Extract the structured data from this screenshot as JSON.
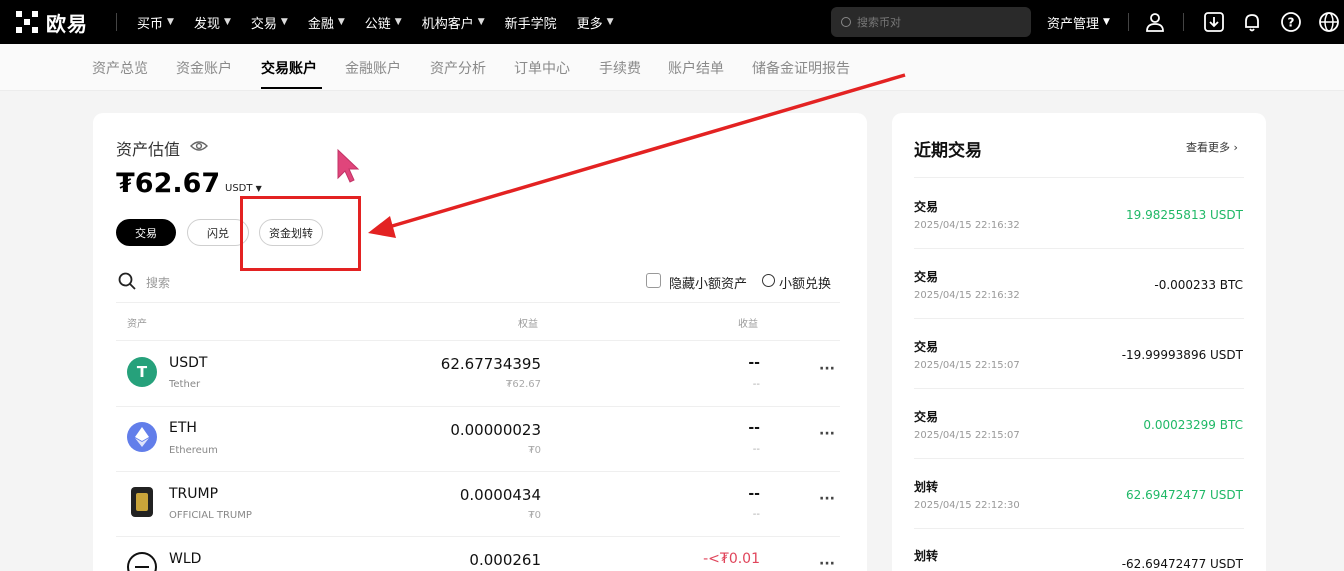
{
  "brand": {
    "name": "欧易"
  },
  "topnav": {
    "items": [
      "买币",
      "发现",
      "交易",
      "金融",
      "公链",
      "机构客户",
      "新手学院",
      "更多"
    ],
    "search_placeholder": "搜索币对",
    "asset_mgmt": "资产管理"
  },
  "subtabs": [
    "资产总览",
    "资金账户",
    "交易账户",
    "金融账户",
    "资产分析",
    "订单中心",
    "手续费",
    "账户结单",
    "储备金证明报告"
  ],
  "summary": {
    "title": "资产估值",
    "balance": "₮62.67",
    "unit": "USDT",
    "buttons": {
      "trade": "交易",
      "swap": "闪兑",
      "transfer": "资金划转"
    }
  },
  "asset_filter": {
    "search_placeholder": "搜索",
    "hide_small": "隐藏小额资产",
    "small_convert": "小额兑换"
  },
  "table": {
    "headers": {
      "asset": "资产",
      "equity": "权益",
      "pnl": "收益"
    },
    "rows": [
      {
        "symbol": "USDT",
        "name": "Tether",
        "equity": "62.67734395",
        "equity_sub": "₮62.67",
        "pnl": "--",
        "pnl_sub": "--",
        "color": "#26a17b"
      },
      {
        "symbol": "ETH",
        "name": "Ethereum",
        "equity": "0.00000023",
        "equity_sub": "₮0",
        "pnl": "--",
        "pnl_sub": "--",
        "color": "#627eea"
      },
      {
        "symbol": "TRUMP",
        "name": "OFFICIAL TRUMP",
        "equity": "0.0000434",
        "equity_sub": "₮0",
        "pnl": "--",
        "pnl_sub": "--",
        "color": "#222222"
      },
      {
        "symbol": "WLD",
        "name": "",
        "equity": "0.000261",
        "equity_sub": "",
        "pnl": "-<₮0.01",
        "pnl_sub": "",
        "color": "#111111"
      }
    ]
  },
  "recent": {
    "title": "近期交易",
    "view_more": "查看更多",
    "items": [
      {
        "type": "交易",
        "time": "2025/04/15 22:16:32",
        "amount": "19.98255813 USDT",
        "positive": true
      },
      {
        "type": "交易",
        "time": "2025/04/15 22:16:32",
        "amount": "-0.000233 BTC",
        "positive": false
      },
      {
        "type": "交易",
        "time": "2025/04/15 22:15:07",
        "amount": "-19.99993896 USDT",
        "positive": false
      },
      {
        "type": "交易",
        "time": "2025/04/15 22:15:07",
        "amount": "0.00023299 BTC",
        "positive": true
      },
      {
        "type": "划转",
        "time": "2025/04/15 22:12:30",
        "amount": "62.69472477 USDT",
        "positive": true
      },
      {
        "type": "划转",
        "time": "",
        "amount": "-62.69472477 USDT",
        "positive": false
      }
    ]
  },
  "colors": {
    "accent_red": "#e32222",
    "positive_green": "#1fb866",
    "negative_red": "#e0455b"
  }
}
